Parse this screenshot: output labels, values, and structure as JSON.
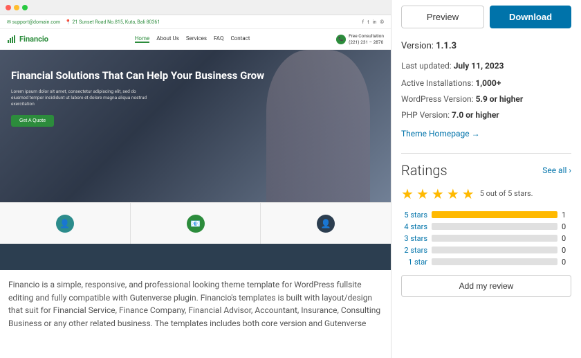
{
  "header": {
    "preview_label": "Preview",
    "download_label": "Download"
  },
  "meta": {
    "version_label": "Version:",
    "version_value": "1.1.3",
    "last_updated_label": "Last updated:",
    "last_updated_value": "July 11, 2023",
    "active_installs_label": "Active Installations:",
    "active_installs_value": "1,000+",
    "wp_version_label": "WordPress Version:",
    "wp_version_value": "5.9 or higher",
    "php_version_label": "PHP Version:",
    "php_version_value": "7.0 or higher",
    "homepage_label": "Theme Homepage →"
  },
  "ratings": {
    "title": "Ratings",
    "see_all": "See all ›",
    "stars_label": "5 out of 5 stars.",
    "bars": [
      {
        "label": "5 stars",
        "fill_pct": 100,
        "count": 1
      },
      {
        "label": "4 stars",
        "fill_pct": 0,
        "count": 0
      },
      {
        "label": "3 stars",
        "fill_pct": 0,
        "count": 0
      },
      {
        "label": "2 stars",
        "fill_pct": 0,
        "count": 0
      },
      {
        "label": "1 star",
        "fill_pct": 0,
        "count": 0
      }
    ],
    "add_review_label": "Add my review"
  },
  "theme": {
    "topbar_left": "support@domain.com   21 Sunset Road No.815, Kuta, Bali 80361",
    "logo": "Financio",
    "nav_links": [
      "Home",
      "About Us",
      "Services",
      "FAQ",
      "Contact"
    ],
    "hero_title": "Financial Solutions That Can Help Your Business Grow",
    "hero_body": "Lorem ipsum dolor sit amet, consectetur adipiscing elit, sed do eiusmod tempor incididunt ut labore et dolore magna aliqua nostrud exercitation",
    "hero_button": "Get A Quote",
    "phone_label": "Free Consultation\n(221) 231 - 2870",
    "description": "Financio is a simple, responsive, and professional looking theme template for WordPress fullsite editing and fully compatible with Gutenverse plugin. Financio's templates is built with layout/design that suit for Financial Service, Finance Company, Financial Advisor, Accountant, Insurance, Consulting Business or any other related business. The templates includes both core version and Gutenverse"
  }
}
